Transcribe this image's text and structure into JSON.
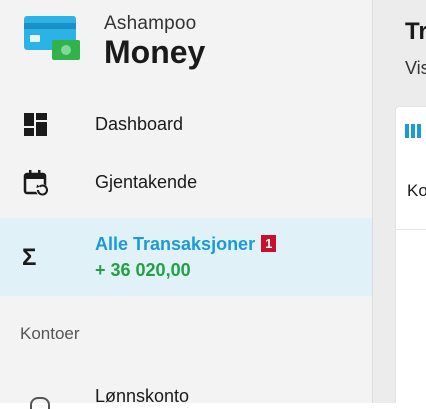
{
  "app": {
    "subtitle": "Ashampoo",
    "title": "Money",
    "logo_icon": "credit-card-money-icon",
    "logo_colors": {
      "card": "#2bb3e8",
      "note": "#2fb34a"
    }
  },
  "sidebar": {
    "items": [
      {
        "label": "Dashboard",
        "icon": "dashboard-grid-icon"
      },
      {
        "label": "Gjentakende",
        "icon": "calendar-recurring-icon"
      },
      {
        "label": "Alle Transaksjoner",
        "icon": "sigma-icon",
        "icon_glyph": "Σ",
        "badge": "1",
        "amount": "+ 36 020,00",
        "active": true
      }
    ],
    "accounts_header": "Kontoer",
    "accounts": [
      {
        "label": "Lønnskonto"
      }
    ]
  },
  "main": {
    "title_partial": "Tr",
    "subtitle_partial": "Vis",
    "column_header_partial": "Ko"
  },
  "colors": {
    "accent": "#1b9bd6",
    "positive": "#22a045",
    "badge": "#c8102e",
    "active_bg": "#e0f2f8"
  }
}
